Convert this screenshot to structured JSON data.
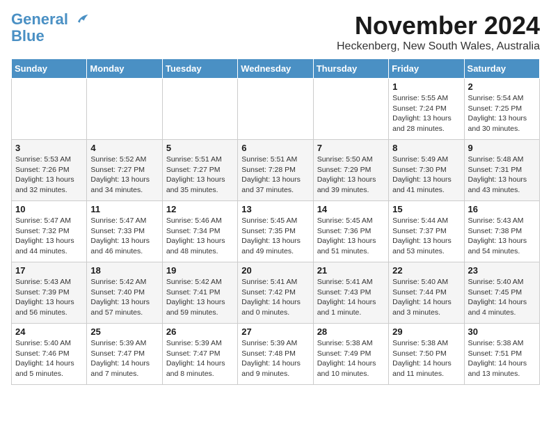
{
  "logo": {
    "line1": "General",
    "line2": "Blue"
  },
  "title": "November 2024",
  "location": "Heckenberg, New South Wales, Australia",
  "days_of_week": [
    "Sunday",
    "Monday",
    "Tuesday",
    "Wednesday",
    "Thursday",
    "Friday",
    "Saturday"
  ],
  "weeks": [
    [
      {
        "day": "",
        "info": ""
      },
      {
        "day": "",
        "info": ""
      },
      {
        "day": "",
        "info": ""
      },
      {
        "day": "",
        "info": ""
      },
      {
        "day": "",
        "info": ""
      },
      {
        "day": "1",
        "info": "Sunrise: 5:55 AM\nSunset: 7:24 PM\nDaylight: 13 hours\nand 28 minutes."
      },
      {
        "day": "2",
        "info": "Sunrise: 5:54 AM\nSunset: 7:25 PM\nDaylight: 13 hours\nand 30 minutes."
      }
    ],
    [
      {
        "day": "3",
        "info": "Sunrise: 5:53 AM\nSunset: 7:26 PM\nDaylight: 13 hours\nand 32 minutes."
      },
      {
        "day": "4",
        "info": "Sunrise: 5:52 AM\nSunset: 7:27 PM\nDaylight: 13 hours\nand 34 minutes."
      },
      {
        "day": "5",
        "info": "Sunrise: 5:51 AM\nSunset: 7:27 PM\nDaylight: 13 hours\nand 35 minutes."
      },
      {
        "day": "6",
        "info": "Sunrise: 5:51 AM\nSunset: 7:28 PM\nDaylight: 13 hours\nand 37 minutes."
      },
      {
        "day": "7",
        "info": "Sunrise: 5:50 AM\nSunset: 7:29 PM\nDaylight: 13 hours\nand 39 minutes."
      },
      {
        "day": "8",
        "info": "Sunrise: 5:49 AM\nSunset: 7:30 PM\nDaylight: 13 hours\nand 41 minutes."
      },
      {
        "day": "9",
        "info": "Sunrise: 5:48 AM\nSunset: 7:31 PM\nDaylight: 13 hours\nand 43 minutes."
      }
    ],
    [
      {
        "day": "10",
        "info": "Sunrise: 5:47 AM\nSunset: 7:32 PM\nDaylight: 13 hours\nand 44 minutes."
      },
      {
        "day": "11",
        "info": "Sunrise: 5:47 AM\nSunset: 7:33 PM\nDaylight: 13 hours\nand 46 minutes."
      },
      {
        "day": "12",
        "info": "Sunrise: 5:46 AM\nSunset: 7:34 PM\nDaylight: 13 hours\nand 48 minutes."
      },
      {
        "day": "13",
        "info": "Sunrise: 5:45 AM\nSunset: 7:35 PM\nDaylight: 13 hours\nand 49 minutes."
      },
      {
        "day": "14",
        "info": "Sunrise: 5:45 AM\nSunset: 7:36 PM\nDaylight: 13 hours\nand 51 minutes."
      },
      {
        "day": "15",
        "info": "Sunrise: 5:44 AM\nSunset: 7:37 PM\nDaylight: 13 hours\nand 53 minutes."
      },
      {
        "day": "16",
        "info": "Sunrise: 5:43 AM\nSunset: 7:38 PM\nDaylight: 13 hours\nand 54 minutes."
      }
    ],
    [
      {
        "day": "17",
        "info": "Sunrise: 5:43 AM\nSunset: 7:39 PM\nDaylight: 13 hours\nand 56 minutes."
      },
      {
        "day": "18",
        "info": "Sunrise: 5:42 AM\nSunset: 7:40 PM\nDaylight: 13 hours\nand 57 minutes."
      },
      {
        "day": "19",
        "info": "Sunrise: 5:42 AM\nSunset: 7:41 PM\nDaylight: 13 hours\nand 59 minutes."
      },
      {
        "day": "20",
        "info": "Sunrise: 5:41 AM\nSunset: 7:42 PM\nDaylight: 14 hours\nand 0 minutes."
      },
      {
        "day": "21",
        "info": "Sunrise: 5:41 AM\nSunset: 7:43 PM\nDaylight: 14 hours\nand 1 minute."
      },
      {
        "day": "22",
        "info": "Sunrise: 5:40 AM\nSunset: 7:44 PM\nDaylight: 14 hours\nand 3 minutes."
      },
      {
        "day": "23",
        "info": "Sunrise: 5:40 AM\nSunset: 7:45 PM\nDaylight: 14 hours\nand 4 minutes."
      }
    ],
    [
      {
        "day": "24",
        "info": "Sunrise: 5:40 AM\nSunset: 7:46 PM\nDaylight: 14 hours\nand 5 minutes."
      },
      {
        "day": "25",
        "info": "Sunrise: 5:39 AM\nSunset: 7:47 PM\nDaylight: 14 hours\nand 7 minutes."
      },
      {
        "day": "26",
        "info": "Sunrise: 5:39 AM\nSunset: 7:47 PM\nDaylight: 14 hours\nand 8 minutes."
      },
      {
        "day": "27",
        "info": "Sunrise: 5:39 AM\nSunset: 7:48 PM\nDaylight: 14 hours\nand 9 minutes."
      },
      {
        "day": "28",
        "info": "Sunrise: 5:38 AM\nSunset: 7:49 PM\nDaylight: 14 hours\nand 10 minutes."
      },
      {
        "day": "29",
        "info": "Sunrise: 5:38 AM\nSunset: 7:50 PM\nDaylight: 14 hours\nand 11 minutes."
      },
      {
        "day": "30",
        "info": "Sunrise: 5:38 AM\nSunset: 7:51 PM\nDaylight: 14 hours\nand 13 minutes."
      }
    ]
  ]
}
